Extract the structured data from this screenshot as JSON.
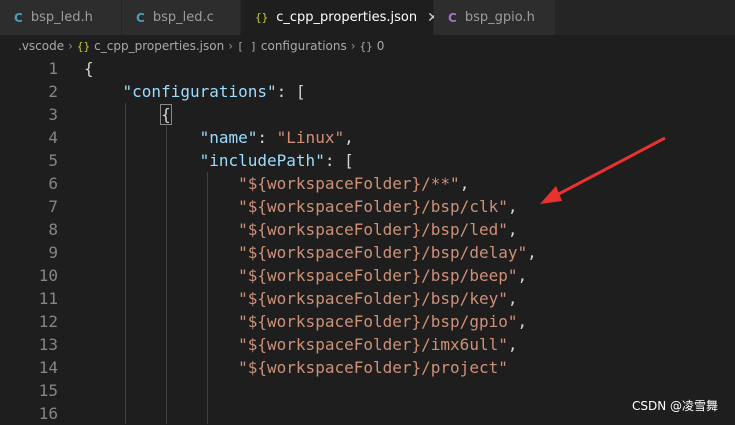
{
  "tabs": [
    {
      "icon": "C",
      "label": "bsp_led.h",
      "active": false
    },
    {
      "icon": "C",
      "label": "bsp_led.c",
      "active": false
    },
    {
      "icon": "{}",
      "label": "c_cpp_properties.json",
      "active": true
    },
    {
      "icon": "C",
      "label": "bsp_gpio.h",
      "active": false
    }
  ],
  "tab_close_glyph": "✕",
  "breadcrumb": {
    "items": [
      ".vscode",
      "c_cpp_properties.json",
      "configurations",
      "0"
    ],
    "icons": [
      "{}",
      "[ ]",
      "{}"
    ]
  },
  "editor": {
    "line_numbers": [
      "1",
      "2",
      "3",
      "4",
      "5",
      "6",
      "7",
      "8",
      "9",
      "10",
      "11",
      "12",
      "13",
      "14",
      "15",
      "16"
    ],
    "lines": {
      "l1": "{",
      "l2_key": "\"configurations\"",
      "l2_rest": ": [",
      "l3": "{",
      "l4_key": "\"name\"",
      "l4_sep": ": ",
      "l4_val": "\"Linux\"",
      "l4_end": ",",
      "l5_key": "\"includePath\"",
      "l5_rest": ": [",
      "paths": [
        "\"${workspaceFolder}/**\"",
        "\"${workspaceFolder}/bsp/clk\"",
        "\"${workspaceFolder}/bsp/led\"",
        "\"${workspaceFolder}/bsp/delay\"",
        "\"${workspaceFolder}/bsp/beep\"",
        "\"${workspaceFolder}/bsp/key\"",
        "\"${workspaceFolder}/bsp/gpio\"",
        "\"${workspaceFolder}/imx6ull\"",
        "\"${workspaceFolder}/project\""
      ],
      "comma": ","
    }
  },
  "watermark": "CSDN @凌雪舞",
  "colors": {
    "background": "#1e1e1e",
    "key": "#9cdcfe",
    "string": "#ce9178",
    "arrow": "#e8322f"
  }
}
